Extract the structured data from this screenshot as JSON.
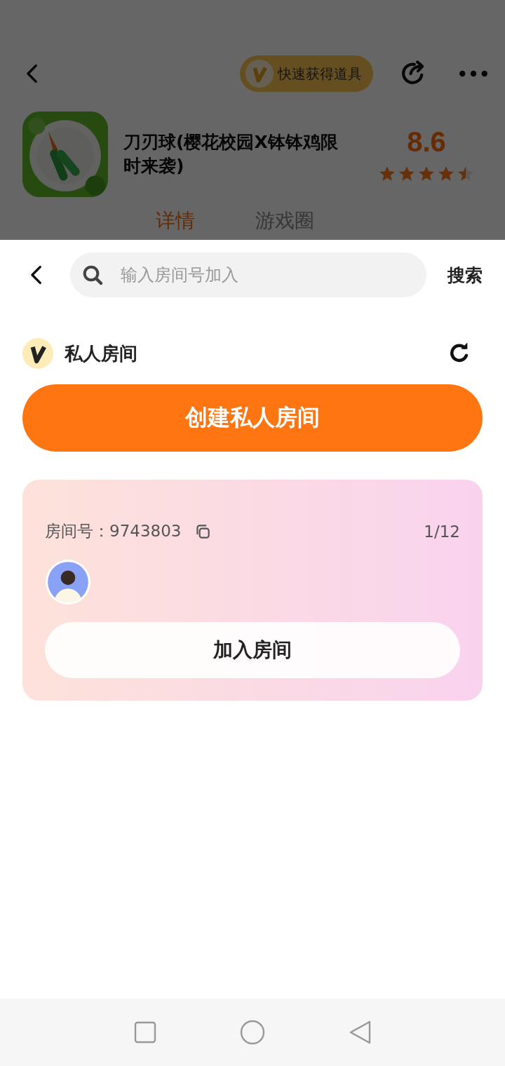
{
  "header": {
    "badge": "快速获得道具"
  },
  "app": {
    "title": "刀刃球(樱花校园X钵钵鸡限时来袭)",
    "score": "8.6",
    "stars": 4.5
  },
  "tabs": [
    {
      "label": "详情",
      "selected": true
    },
    {
      "label": "游戏圈",
      "selected": false
    }
  ],
  "sheet": {
    "search": {
      "placeholder": "输入房间号加入"
    },
    "search_button": "搜索",
    "section_title": "私人房间",
    "create_button": "创建私人房间",
    "rooms": [
      {
        "room_label": "房间号：9743803",
        "count": "1/12",
        "join_button": "加入房间"
      }
    ]
  }
}
